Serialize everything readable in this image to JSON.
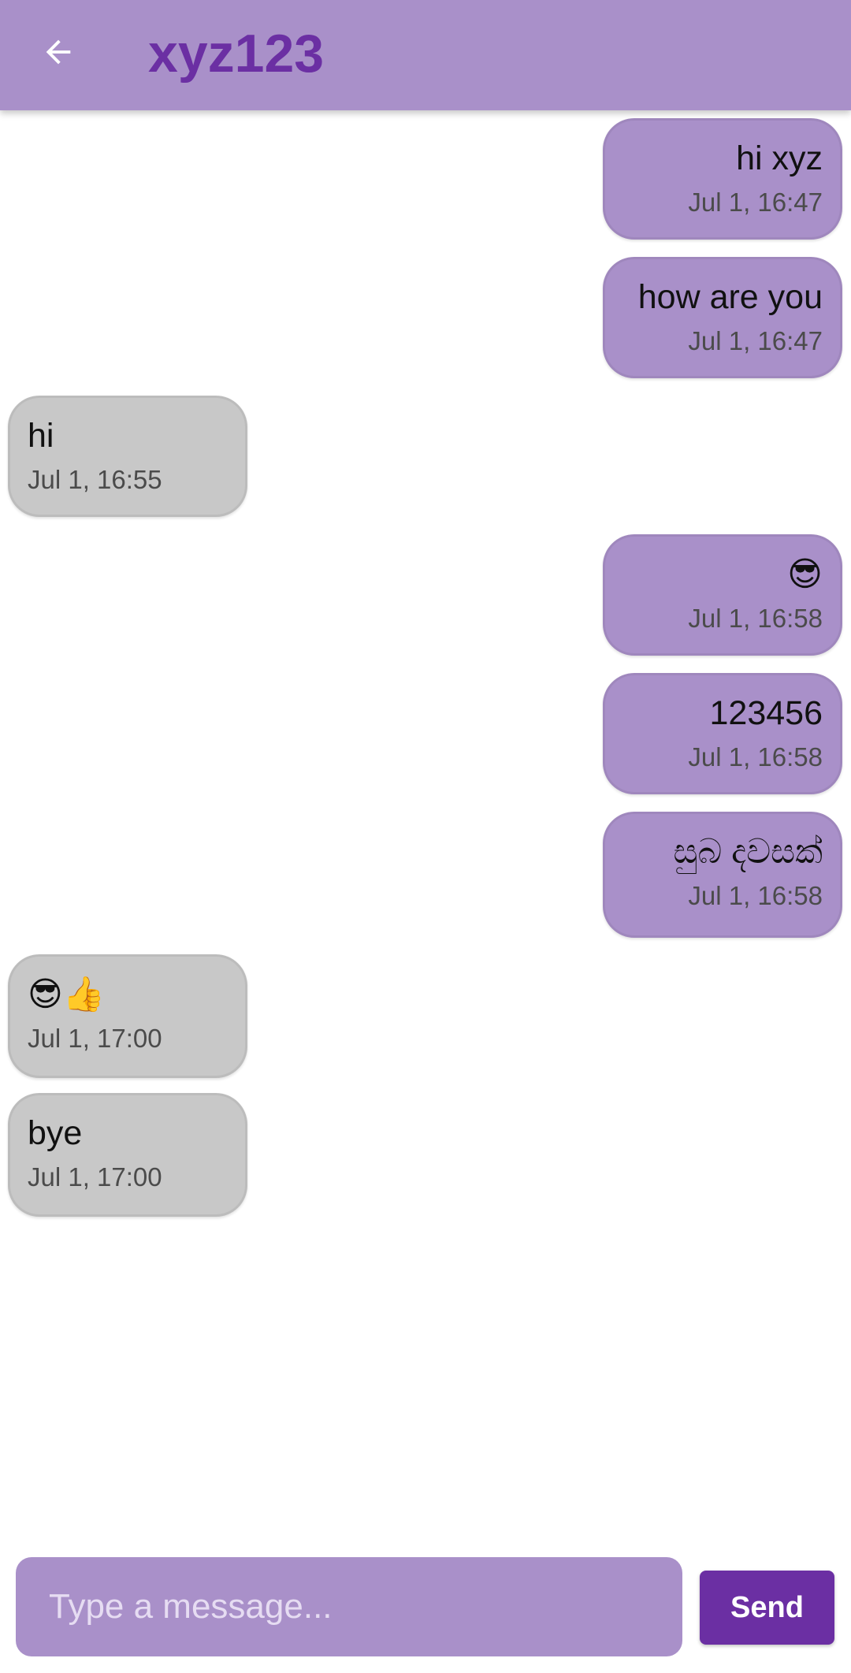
{
  "header": {
    "back_icon": "arrow-left-icon",
    "title": "xyz123"
  },
  "messages": [
    {
      "sender": "me",
      "text": "hi xyz",
      "time": "Jul 1, 16:47"
    },
    {
      "sender": "me",
      "text": "how are you",
      "time": "Jul 1, 16:47"
    },
    {
      "sender": "them",
      "text": "hi",
      "time": "Jul 1, 16:55"
    },
    {
      "sender": "me",
      "text": "😎",
      "time": "Jul 1, 16:58"
    },
    {
      "sender": "me",
      "text": "123456",
      "time": "Jul 1, 16:58"
    },
    {
      "sender": "me",
      "text": "සුබ දවසක්",
      "time": "Jul 1, 16:58"
    },
    {
      "sender": "them",
      "text": "😎👍",
      "time": "Jul 1, 17:00"
    },
    {
      "sender": "them",
      "text": "bye",
      "time": "Jul 1, 17:00"
    }
  ],
  "composer": {
    "placeholder": "Type a message...",
    "value": "",
    "send_label": "Send"
  },
  "colors": {
    "accent": "#a990c9",
    "title": "#6b2fa3",
    "send_button": "#6b2fa3",
    "incoming_bubble": "#c8c8c8"
  }
}
